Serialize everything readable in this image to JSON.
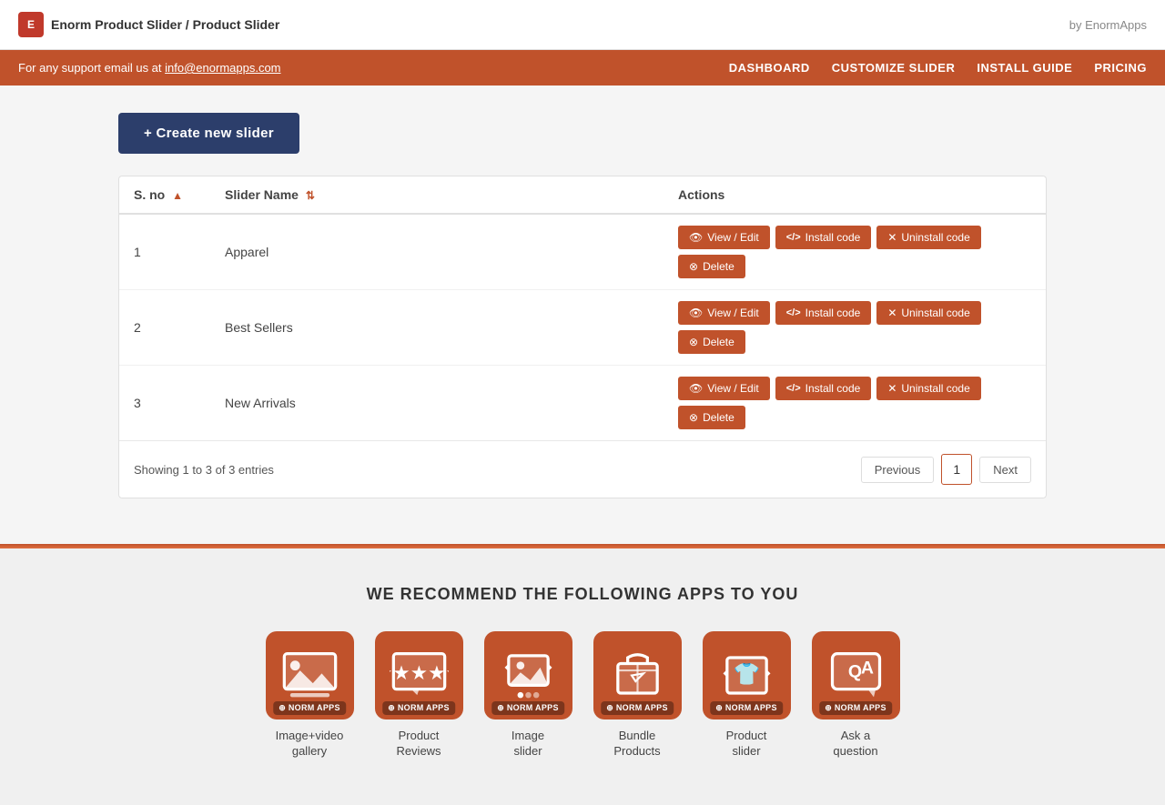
{
  "topbar": {
    "app_icon_label": "E",
    "breadcrumb_text": "Enorm Product Slider / ",
    "breadcrumb_bold": "Product Slider",
    "by_label": "by EnormApps"
  },
  "navbar": {
    "support_text": "For any support email us at ",
    "support_email": "info@enormapps.com",
    "nav_items": [
      {
        "id": "dashboard",
        "label": "DASHBOARD"
      },
      {
        "id": "customize",
        "label": "CUSTOMIZE SLIDER"
      },
      {
        "id": "install",
        "label": "INSTALL GUIDE"
      },
      {
        "id": "pricing",
        "label": "PRICING"
      }
    ]
  },
  "create_button": "+ Create new slider",
  "table": {
    "columns": [
      {
        "id": "sno",
        "label": "S. no"
      },
      {
        "id": "slider_name",
        "label": "Slider Name"
      },
      {
        "id": "actions",
        "label": "Actions"
      }
    ],
    "rows": [
      {
        "sno": "1",
        "name": "Apparel",
        "actions": {
          "view": "View / Edit",
          "install": "Install code",
          "uninstall": "Uninstall code",
          "delete": "Delete"
        }
      },
      {
        "sno": "2",
        "name": "Best Sellers",
        "actions": {
          "view": "View / Edit",
          "install": "Install code",
          "uninstall": "Uninstall code",
          "delete": "Delete"
        }
      },
      {
        "sno": "3",
        "name": "New Arrivals",
        "actions": {
          "view": "View / Edit",
          "install": "Install code",
          "uninstall": "Uninstall code",
          "delete": "Delete"
        }
      }
    ]
  },
  "pagination": {
    "showing_text": "Showing 1 to 3 of 3 entries",
    "previous_label": "Previous",
    "current_page": "1",
    "next_label": "Next"
  },
  "recommendations": {
    "title": "WE RECOMMEND THE FOLLOWING APPS TO YOU",
    "apps": [
      {
        "id": "image-video-gallery",
        "label": "Image+video\ngallery",
        "icon_type": "gallery"
      },
      {
        "id": "product-reviews",
        "label": "Product\nReviews",
        "icon_type": "reviews"
      },
      {
        "id": "image-slider",
        "label": "Image\nslider",
        "icon_type": "slider"
      },
      {
        "id": "bundle-products",
        "label": "Bundle\nProducts",
        "icon_type": "bundle"
      },
      {
        "id": "product-slider",
        "label": "Product\nslider",
        "icon_type": "product-slider"
      },
      {
        "id": "ask-a-question",
        "label": "Ask a\nquestion",
        "icon_type": "question"
      }
    ]
  }
}
